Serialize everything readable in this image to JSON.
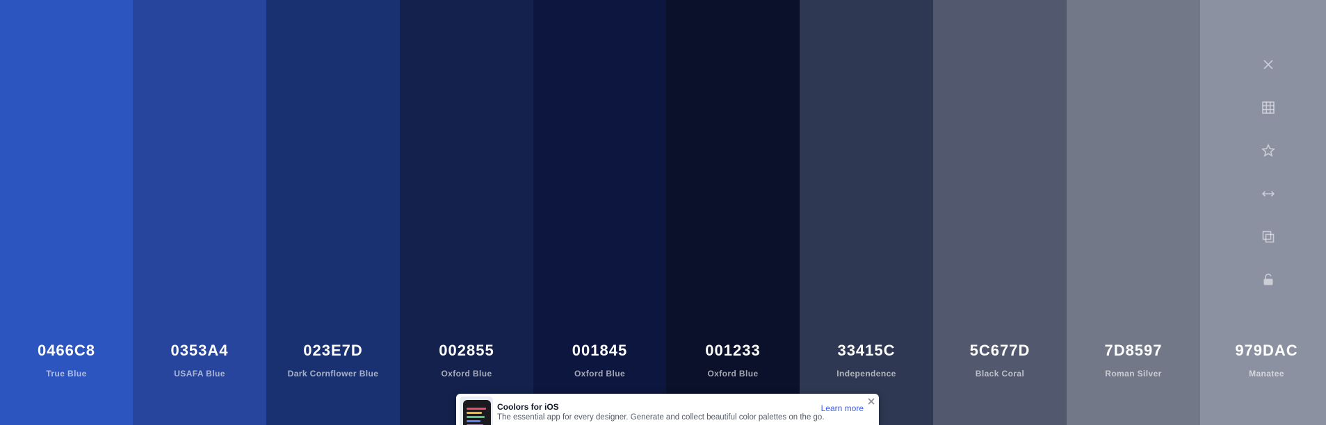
{
  "swatches": [
    {
      "hex": "0466C8",
      "name": "True Blue",
      "color": "#2c55bf",
      "text": "#ffffff"
    },
    {
      "hex": "0353A4",
      "name": "USAFA Blue",
      "color": "#27459d",
      "text": "#ffffff"
    },
    {
      "hex": "023E7D",
      "name": "Dark Cornflower Blue",
      "color": "#1a3171",
      "text": "#ffffff"
    },
    {
      "hex": "002855",
      "name": "Oxford Blue",
      "color": "#13214c",
      "text": "#ffffff"
    },
    {
      "hex": "001845",
      "name": "Oxford Blue",
      "color": "#0d163f",
      "text": "#ffffff"
    },
    {
      "hex": "001233",
      "name": "Oxford Blue",
      "color": "#0b112b",
      "text": "#ffffff"
    },
    {
      "hex": "33415C",
      "name": "Independence",
      "color": "#2e3852",
      "text": "#ffffff"
    },
    {
      "hex": "5C677D",
      "name": "Black Coral",
      "color": "#52586d",
      "text": "#ffffff"
    },
    {
      "hex": "7D8597",
      "name": "Roman Silver",
      "color": "#737889",
      "text": "#ffffff"
    },
    {
      "hex": "979DAC",
      "name": "Manatee",
      "color": "#8c91a1",
      "text": "#ffffff"
    }
  ],
  "toolbar": [
    {
      "icon": "close-icon"
    },
    {
      "icon": "grid-icon"
    },
    {
      "icon": "star-icon"
    },
    {
      "icon": "drag-arrows-icon"
    },
    {
      "icon": "copy-icon"
    },
    {
      "icon": "unlock-icon"
    }
  ],
  "ad": {
    "title": "Coolors for iOS",
    "text": "The essential app for every designer. Generate and collect beautiful color palettes on the go.",
    "link": "Learn more"
  }
}
